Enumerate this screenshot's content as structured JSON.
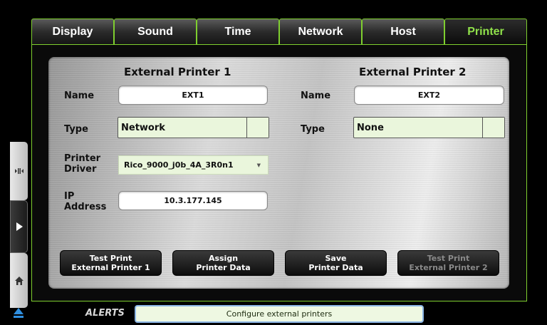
{
  "tabs": [
    {
      "label": "Display"
    },
    {
      "label": "Sound"
    },
    {
      "label": "Time"
    },
    {
      "label": "Network"
    },
    {
      "label": "Host"
    },
    {
      "label": "Printer",
      "active": true
    }
  ],
  "printer1": {
    "header": "External Printer 1",
    "name_label": "Name",
    "name_value": "EXT1",
    "type_label": "Type",
    "type_value": "Network",
    "driver_label_line1": "Printer",
    "driver_label_line2": "Driver",
    "driver_value": "Rico_9000_j0b_4A_3R0n1",
    "ip_label_line1": "IP",
    "ip_label_line2": "Address",
    "ip_value": "10.3.177.145"
  },
  "printer2": {
    "header": "External Printer 2",
    "name_label": "Name",
    "name_value": "EXT2",
    "type_label": "Type",
    "type_value": "None"
  },
  "buttons": {
    "test1_line1": "Test Print",
    "test1_line2": "External Printer 1",
    "assign_line1": "Assign",
    "assign_line2": "Printer Data",
    "save_line1": "Save",
    "save_line2": "Printer Data",
    "test2_line1": "Test Print",
    "test2_line2": "External Printer 2"
  },
  "alerts": {
    "label": "ALERTS",
    "message": "Configure external printers"
  },
  "colors": {
    "accent_green": "#7fcf2f",
    "active_tab_text": "#8fe04a",
    "field_green": "#eaf6dc",
    "eject_blue": "#2f8fe0"
  },
  "icons": {
    "side1": "audio-route-icon",
    "side2": "play-arrow-icon",
    "side3": "home-icon",
    "bottom": "eject-icon"
  }
}
